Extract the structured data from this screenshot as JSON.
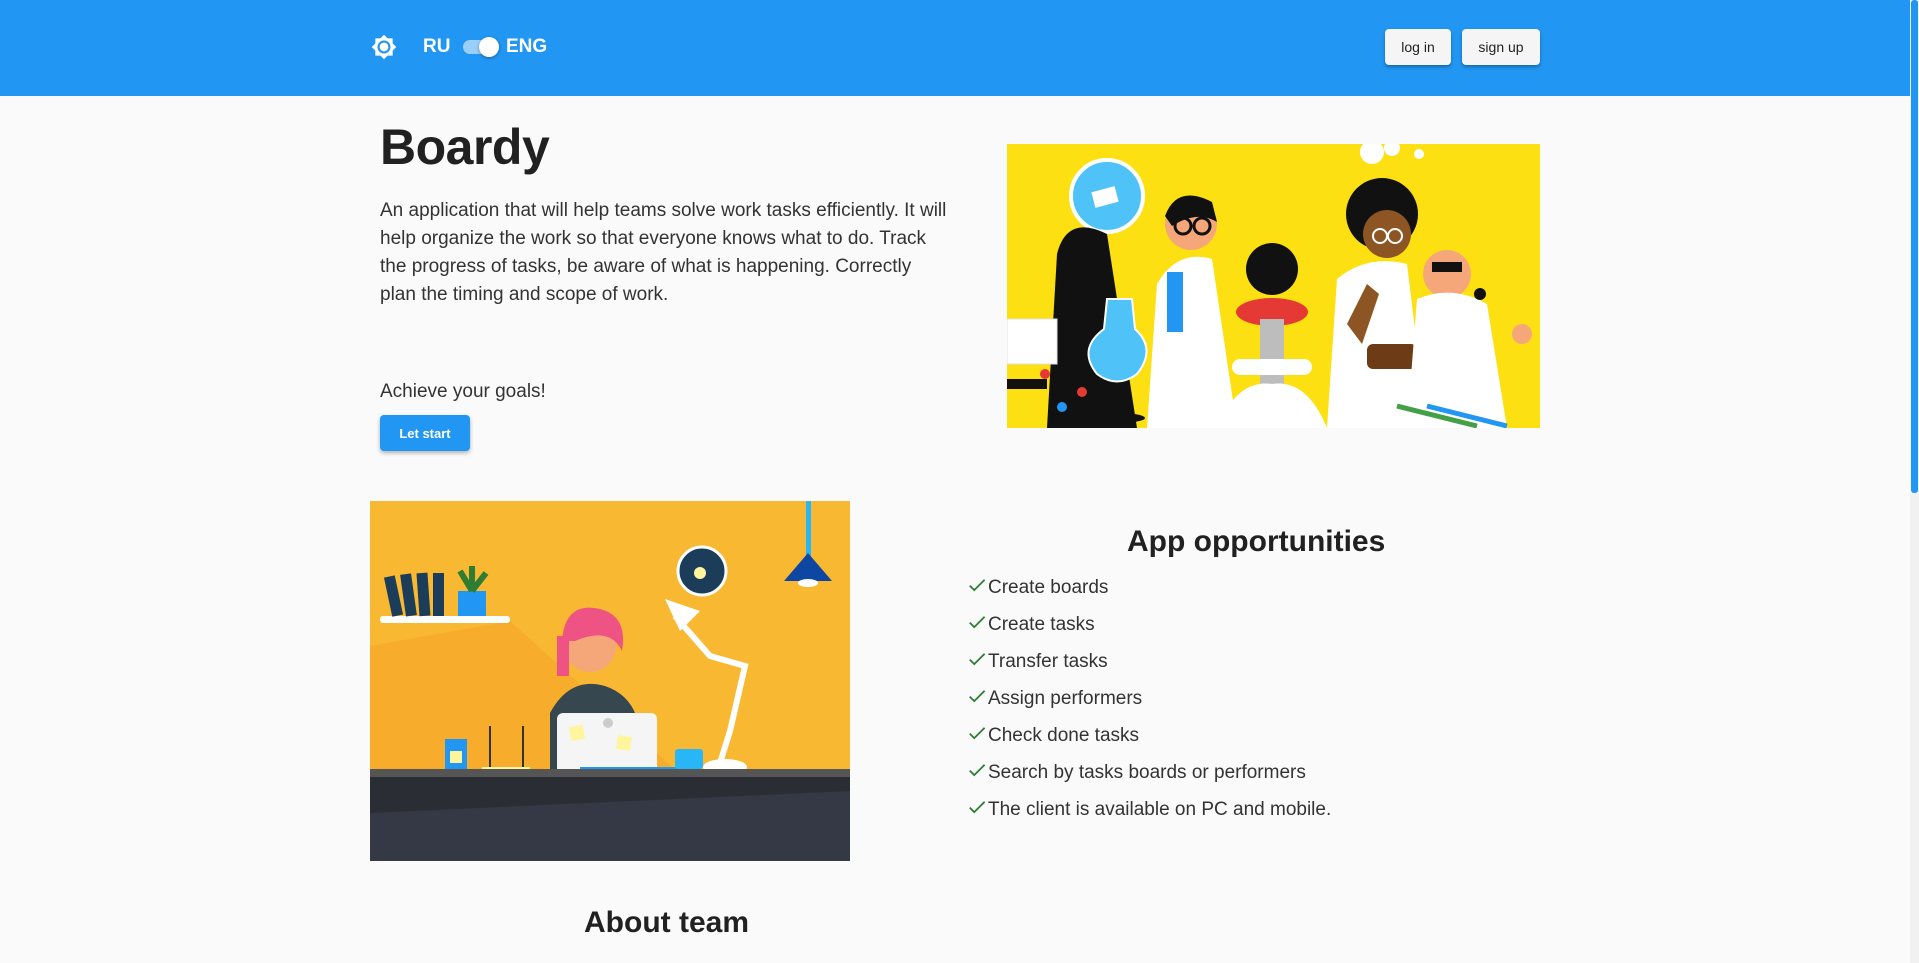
{
  "header": {
    "theme_icon": "brightness-gear-icon",
    "lang_left": "RU",
    "lang_right": "ENG",
    "login_label": "log in",
    "signup_label": "sign up",
    "background_color": "#2196f3"
  },
  "hero": {
    "title": "Boardy",
    "description": "An application that will help teams solve work tasks efficiently. It will help organize the work so that everyone knows what to do. Track the progress of tasks, be aware of what is happening. Correctly plan the timing and scope of work.",
    "goal_text": "Achieve your goals!",
    "start_label": "Let start",
    "image": "scientists-illustration"
  },
  "opportunities": {
    "title": "App opportunities",
    "image": "office-worker-illustration",
    "check_color": "#2e7d32",
    "items": [
      "Create boards",
      "Create tasks",
      "Transfer tasks",
      "Assign performers",
      "Check done tasks",
      "Search by tasks boards or performers",
      "The client is available on PC and mobile."
    ]
  },
  "about": {
    "title": "About team"
  }
}
